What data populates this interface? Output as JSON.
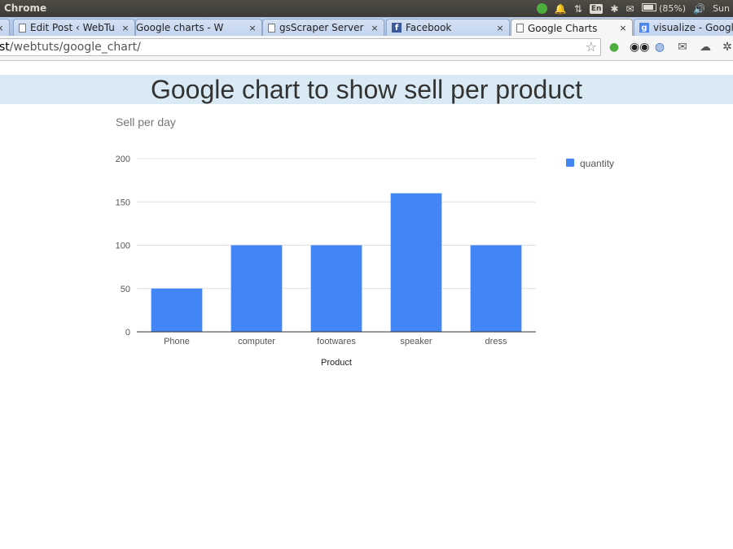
{
  "system_panel": {
    "app_name": "Chrome",
    "keyboard_layout": "En",
    "battery_text": "(85%)",
    "day": "Sun",
    "icons": [
      "status-dot-icon",
      "bell-icon",
      "network-arrows-icon",
      "keyboard-icon",
      "bluetooth-icon",
      "mail-icon",
      "battery-icon",
      "volume-icon"
    ]
  },
  "browser": {
    "tabs": [
      {
        "title": "Edit Post ‹ WebTu",
        "favicon": "page-icon",
        "active": false
      },
      {
        "title": "Google charts - W",
        "favicon": "chart-favicon-icon",
        "active": false
      },
      {
        "title": "gsScraper Server",
        "favicon": "page-icon",
        "active": false
      },
      {
        "title": "Facebook",
        "favicon": "facebook-icon",
        "active": false
      },
      {
        "title": "Google Charts",
        "favicon": "page-icon",
        "active": true
      },
      {
        "title": "visualize - Google",
        "favicon": "google-icon",
        "active": false
      }
    ],
    "close_glyph": "×",
    "address": {
      "host": "st",
      "path": "/webtuts/google_chart/"
    },
    "extension_icons": [
      "evernote-icon",
      "eyes-icon",
      "globe-icon",
      "mail-icon",
      "cloud-icon",
      "bug-icon"
    ]
  },
  "page": {
    "heading": "Google chart to show sell per product"
  },
  "chart_data": {
    "type": "bar",
    "title": "Sell per day",
    "xlabel": "Product",
    "ylabel": "",
    "categories": [
      "Phone",
      "computer",
      "footwares",
      "speaker",
      "dress"
    ],
    "series": [
      {
        "name": "quantity",
        "values": [
          50,
          100,
          100,
          160,
          100
        ],
        "color": "#4285f4"
      }
    ],
    "ylim": [
      0,
      200
    ],
    "yticks": [
      0,
      50,
      100,
      150,
      200
    ],
    "grid": true,
    "legend": "right"
  }
}
